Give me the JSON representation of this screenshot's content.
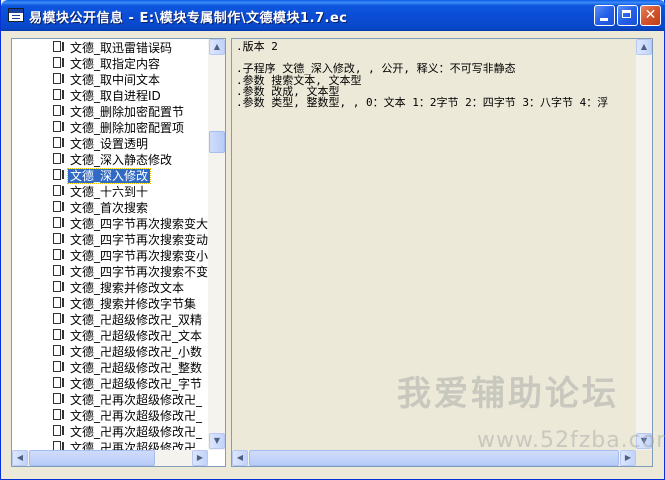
{
  "window": {
    "title": "易模块公开信息 - E:\\模块专属制作\\文德模块1.7.ec",
    "buttons": {
      "close_label": "✕"
    }
  },
  "tree": {
    "items": [
      {
        "label": "文德_取迅雷错误码",
        "selected": false
      },
      {
        "label": "文德_取指定内容",
        "selected": false
      },
      {
        "label": "文德_取中间文本",
        "selected": false
      },
      {
        "label": "文德_取自进程ID",
        "selected": false
      },
      {
        "label": "文德_删除加密配置节",
        "selected": false
      },
      {
        "label": "文德_删除加密配置项",
        "selected": false
      },
      {
        "label": "文德_设置透明",
        "selected": false
      },
      {
        "label": "文德_深入静态修改",
        "selected": false
      },
      {
        "label": "文德_深入修改",
        "selected": true
      },
      {
        "label": "文德_十六到十",
        "selected": false
      },
      {
        "label": "文德_首次搜索",
        "selected": false
      },
      {
        "label": "文德_四字节再次搜索变大",
        "selected": false
      },
      {
        "label": "文德_四字节再次搜索变动",
        "selected": false
      },
      {
        "label": "文德_四字节再次搜索变小",
        "selected": false
      },
      {
        "label": "文德_四字节再次搜索不变",
        "selected": false
      },
      {
        "label": "文德_搜索并修改文本",
        "selected": false
      },
      {
        "label": "文德_搜索并修改字节集",
        "selected": false
      },
      {
        "label": "文德_卍超级修改卍_双精",
        "selected": false
      },
      {
        "label": "文德_卍超级修改卍_文本",
        "selected": false
      },
      {
        "label": "文德_卍超级修改卍_小数",
        "selected": false
      },
      {
        "label": "文德_卍超级修改卍_整数",
        "selected": false
      },
      {
        "label": "文德_卍超级修改卍_字节",
        "selected": false
      },
      {
        "label": "文德_卍再次超级修改卍_",
        "selected": false
      },
      {
        "label": "文德_卍再次超级修改卍_",
        "selected": false
      },
      {
        "label": "文德_卍再次超级修改卍_",
        "selected": false
      },
      {
        "label": "文德_卍再次超级修改卍_",
        "selected": false
      }
    ]
  },
  "code": {
    "lines": [
      ".版本 2",
      "",
      ".子程序 文德_深入修改, , 公开, 释义：不可写非静态",
      ".参数 搜索文本, 文本型",
      ".参数 改成, 文本型",
      ".参数 类型, 整数型, , 0：文本 1：2字节 2：四字节 3：八字节 4：浮"
    ]
  },
  "watermark": {
    "line1": "我爱辅助论坛",
    "line2": "www.52fzba.com"
  },
  "scrollbar": {
    "up_icon": "▲",
    "down_icon": "▼",
    "left_icon": "◀",
    "right_icon": "▶"
  }
}
